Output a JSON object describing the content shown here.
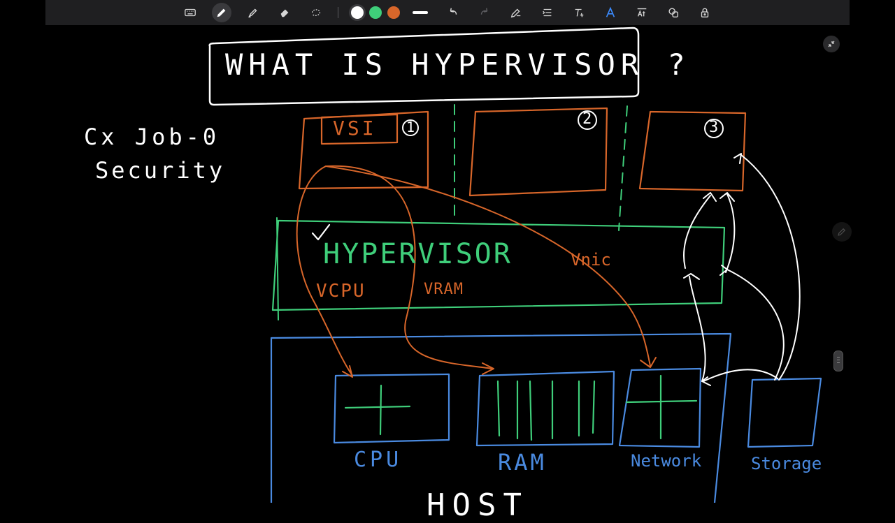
{
  "colors": {
    "white": "#ffffff",
    "green": "#3fce7a",
    "orange": "#d8662a",
    "blue": "#4a8ae0",
    "toolbar_bg": "#1f1f21"
  },
  "toolbar": {
    "tools": [
      {
        "name": "keyboard-icon"
      },
      {
        "name": "pen-icon"
      },
      {
        "name": "highlighter-icon"
      },
      {
        "name": "eraser-icon"
      },
      {
        "name": "lasso-icon"
      }
    ],
    "swatches": [
      "#ffffff",
      "#3fce7a",
      "#d8662a"
    ],
    "actions": [
      {
        "name": "undo-icon"
      },
      {
        "name": "redo-icon"
      },
      {
        "name": "shape-pen-icon"
      },
      {
        "name": "text-align-icon"
      },
      {
        "name": "text-tool-icon"
      },
      {
        "name": "handwriting-icon"
      },
      {
        "name": "text-convert-icon"
      },
      {
        "name": "shapes-icon"
      },
      {
        "name": "lock-icon"
      }
    ]
  },
  "note": {
    "title": "WHAT IS HYPERVISOR ?",
    "side_notes": [
      "Cx Job-0",
      "Security"
    ],
    "vm_numbers": [
      "1",
      "2",
      "3"
    ],
    "vsi_label": "VSI",
    "hypervisor_label": "HYPERVISOR",
    "virtual_labels": {
      "vcpu": "VCPU",
      "vram": "VRAM",
      "vnic": "Vnic"
    },
    "host_components": [
      "CPU",
      "RAM",
      "Network",
      "Storage"
    ],
    "host_label": "HOST"
  }
}
